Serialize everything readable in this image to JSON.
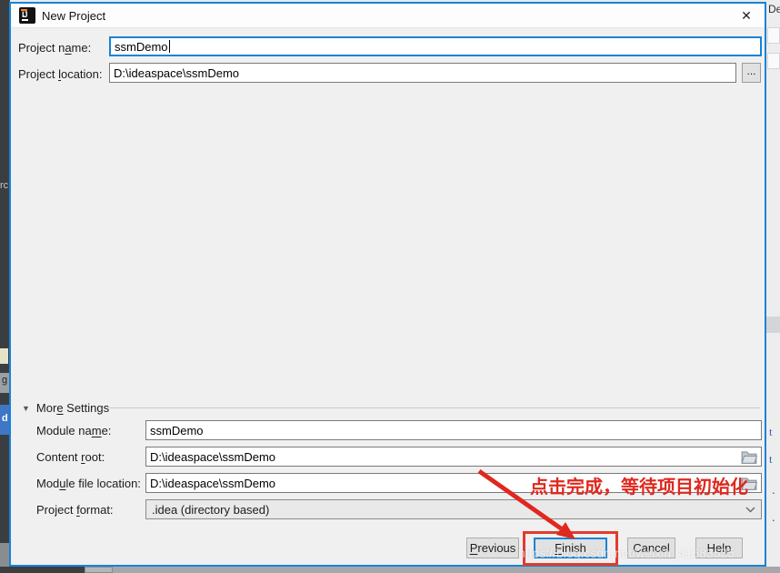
{
  "window": {
    "title": "New Project",
    "close_glyph": "✕",
    "ij_text": "IJ"
  },
  "labels": {
    "project_name": {
      "pre": "Project n",
      "key": "a",
      "post": "me:"
    },
    "project_location": {
      "pre": "Project ",
      "key": "l",
      "post": "ocation:"
    },
    "more_settings": {
      "pre": "Mor",
      "key": "e",
      "post": " Settings"
    },
    "module_name": {
      "pre": "Module na",
      "key": "m",
      "post": "e:"
    },
    "content_root": {
      "pre": "Content ",
      "key": "r",
      "post": "oot:"
    },
    "module_file_location": {
      "pre": "Mod",
      "key": "u",
      "post": "le file location:"
    },
    "project_format": {
      "pre": "Project ",
      "key": "f",
      "post": "ormat:"
    }
  },
  "fields": {
    "project_name": "ssmDemo",
    "project_location": "D:\\ideaspace\\ssmDemo",
    "module_name": "ssmDemo",
    "content_root": "D:\\ideaspace\\ssmDemo",
    "module_file_location": "D:\\ideaspace\\ssmDemo",
    "project_format": ".idea (directory based)",
    "browse_label": "..."
  },
  "buttons": {
    "previous": {
      "pre": "",
      "key": "P",
      "post": "revious"
    },
    "finish": {
      "pre": "",
      "key": "F",
      "post": "inish"
    },
    "cancel": "Cancel",
    "help": "Help"
  },
  "annotation": {
    "text": "点击完成，等待项目初始化"
  },
  "watermark": "https://blog.csdn.net/weixin_41583535",
  "icons": {
    "window_icon": "intellij-ij-logo",
    "collapse_glyph": "▼",
    "folder": "open-folder",
    "combo": "chevron-down",
    "close": "close-x"
  },
  "background": {
    "left_fragments": {
      "tree": "rc",
      "g": "g",
      "d": "d"
    },
    "right_fragments": {
      "top": "De",
      "t1": "t",
      "t2": "t",
      "dot1": ".",
      "dot2": "."
    }
  },
  "colors": {
    "accent_blue": "#1883d7",
    "annotation_red": "#e0281e"
  }
}
